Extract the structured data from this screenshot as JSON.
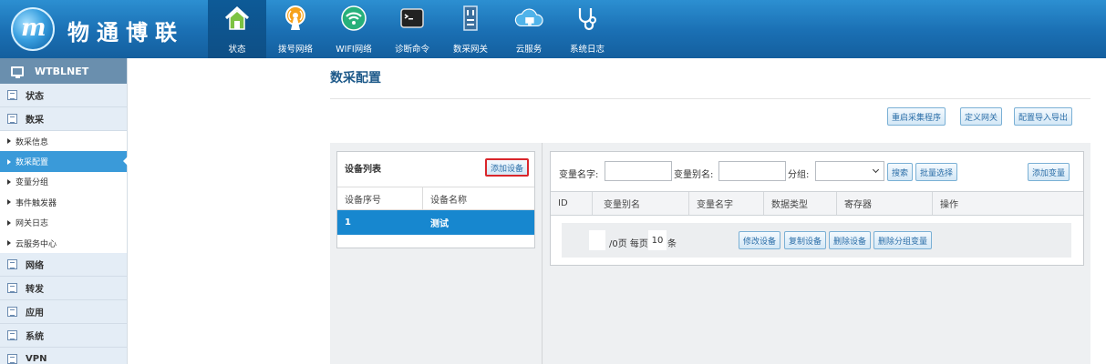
{
  "brand": {
    "logo_glyph": "m",
    "name": "物通博联"
  },
  "nav": [
    {
      "label": "状态",
      "icon": "house-icon",
      "active": true
    },
    {
      "label": "拨号网络",
      "icon": "dial-signal-icon"
    },
    {
      "label": "WIFI网络",
      "icon": "wifi-icon"
    },
    {
      "label": "诊断命令",
      "icon": "terminal-icon"
    },
    {
      "label": "数采网关",
      "icon": "server-rack-icon"
    },
    {
      "label": "云服务",
      "icon": "cloud-monitor-icon"
    },
    {
      "label": "系统日志",
      "icon": "stethoscope-icon"
    }
  ],
  "sidebar": {
    "device_name": "WTBLNET",
    "sections": {
      "status": "状态",
      "collection": "数采",
      "network": "网络",
      "forward": "转发",
      "application": "应用",
      "system": "系统",
      "vpn": "VPN"
    },
    "collection_items": [
      "数采信息",
      "数采配置",
      "变量分组",
      "事件触发器",
      "网关日志",
      "云服务中心"
    ],
    "active_item": "数采配置"
  },
  "page": {
    "title": "数采配置"
  },
  "toolbar": {
    "restart_label": "重启采集程序",
    "define_gateway_label": "定义网关",
    "import_export_label": "配置导入导出"
  },
  "device_list": {
    "title": "设备列表",
    "add_button": "添加设备",
    "columns": [
      "设备序号",
      "设备名称"
    ],
    "rows": [
      {
        "index": "1",
        "name": "测试"
      }
    ]
  },
  "variables": {
    "filter": {
      "name_label": "变量名字:",
      "alias_label": "变量别名:",
      "group_label": "分组:",
      "search_button": "搜索",
      "batch_button": "批量选择",
      "add_button": "添加变量"
    },
    "columns": [
      "ID",
      "变量别名",
      "变量名字",
      "数据类型",
      "寄存器",
      "操作"
    ],
    "pager": {
      "page_suffix": "/0页 每页",
      "per_page": "10",
      "unit": "条"
    },
    "actions": [
      "修改设备",
      "复制设备",
      "删除设备",
      "删除分组变量"
    ]
  },
  "colors": {
    "header": "#1a6fb3",
    "accent": "#1787cf",
    "sidebar_head": "#6a8fae"
  }
}
